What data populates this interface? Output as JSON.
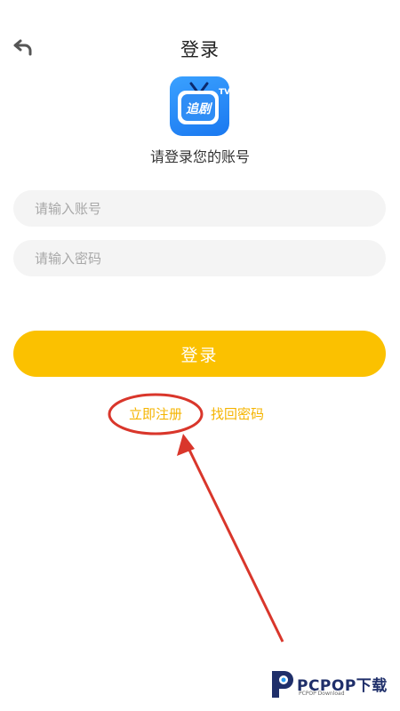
{
  "header": {
    "title": "登录",
    "back_icon": "back-arrow-icon"
  },
  "logo": {
    "text": "追剧",
    "badge": "TV",
    "icon": "tv-app-logo-icon",
    "color": "#2b8cf7"
  },
  "subtitle": "请登录您的账号",
  "form": {
    "account_placeholder": "请输入账号",
    "account_value": "",
    "password_placeholder": "请输入密码",
    "password_value": ""
  },
  "actions": {
    "login_label": "登录",
    "register_label": "立即注册",
    "forgot_label": "找回密码"
  },
  "colors": {
    "accent": "#fbc100",
    "link": "#f5b400",
    "annotation": "#d9362b"
  },
  "watermark": {
    "brand": "PCPOP下载",
    "tagline": "PCPOP Download"
  }
}
